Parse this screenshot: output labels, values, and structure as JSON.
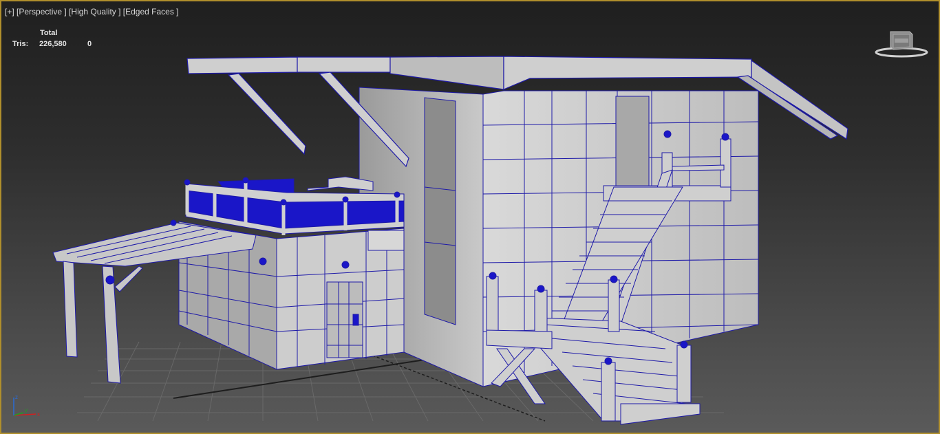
{
  "viewport": {
    "labels": [
      "[+]",
      "[Perspective ]",
      "[High Quality ]",
      "[Edged Faces ]"
    ],
    "border_color": "#b08f2c",
    "wire_color": "#1e1aa8",
    "accent_blue": "#1a16c8"
  },
  "stats": {
    "header": "Total",
    "tris_label": "Tris:",
    "tris_total": "226,580",
    "tris_selected": "0"
  },
  "viewcube": {
    "label": "ViewCube",
    "icon": "viewcube-icon"
  },
  "axis_tripod": {
    "icon": "axis-tripod-icon",
    "x": "x",
    "y": "y",
    "z": "z"
  }
}
